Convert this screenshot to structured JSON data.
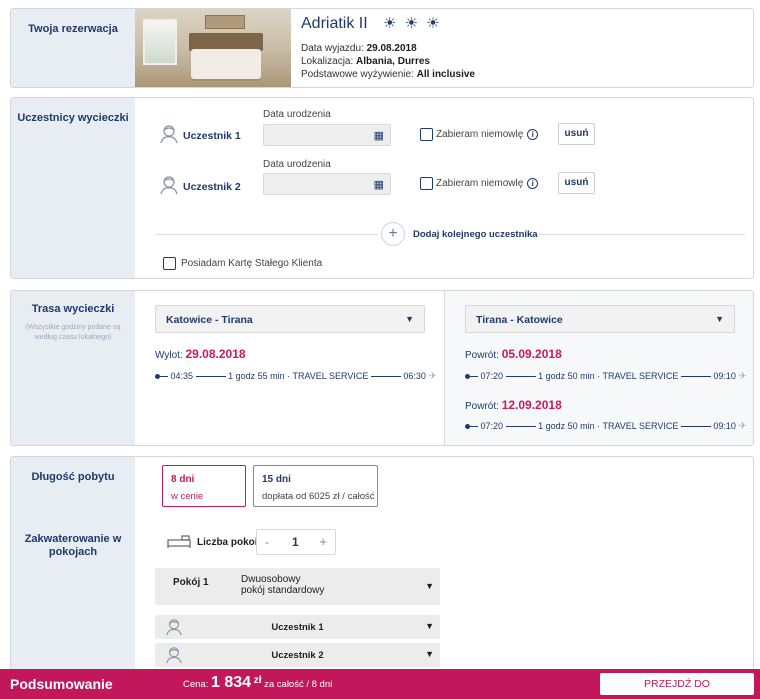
{
  "reservation": {
    "section_title": "Twoja rezerwacja",
    "hotel_name": "Adriatik II",
    "stars": "☀ ☀ ☀",
    "departure_label": "Data wyjazdu:",
    "departure_value": "29.08.2018",
    "location_label": "Lokalizacja:",
    "location_value": "Albania, Durres",
    "board_label": "Podstawowe wyżywienie:",
    "board_value": "All inclusive"
  },
  "participants": {
    "section_title": "Uczestnicy wycieczki",
    "items": [
      {
        "name": "Uczestnik 1",
        "dob_label": "Data urodzenia",
        "dob_value": "",
        "infant_label": "Zabieram niemowlę",
        "remove_label": "usuń"
      },
      {
        "name": "Uczestnik 2",
        "dob_label": "Data urodzenia",
        "dob_value": "",
        "infant_label": "Zabieram niemowlę",
        "remove_label": "usuń"
      }
    ],
    "add_label": "Dodaj kolejnego uczestnika",
    "loyalty_label": "Posiadam Kartę Stałego Klienta"
  },
  "route": {
    "section_title": "Trasa wycieczki",
    "note": "(Wszystkie godziny podane są według czasu lokalnego)",
    "outbound": {
      "select": "Katowice - Tirana",
      "date_label": "Wylot:",
      "date": "29.08.2018",
      "dep": "04:35",
      "duration": "1 godz 55 min",
      "carrier": "TRAVEL SERVICE",
      "arr": "06:30"
    },
    "return": {
      "select": "Tirana - Katowice",
      "options": [
        {
          "date_label": "Powrót:",
          "date": "05.09.2018",
          "dep": "07:20",
          "duration": "1 godz 50 min",
          "carrier": "TRAVEL SERVICE",
          "arr": "09:10"
        },
        {
          "date_label": "Powrót:",
          "date": "12.09.2018",
          "dep": "07:20",
          "duration": "1 godz 50 min",
          "carrier": "TRAVEL SERVICE",
          "arr": "09:10"
        }
      ]
    }
  },
  "stay": {
    "length_title": "Długość pobytu",
    "options": [
      {
        "days": "8 dni",
        "note": "w cenie",
        "selected": true
      },
      {
        "days": "15 dni",
        "note": "dopłata od 6025 zł / całość",
        "selected": false
      }
    ],
    "accommodation_title": "Zakwaterowanie w pokojach",
    "rooms_label": "Liczba pokoi",
    "rooms_minus": "-",
    "rooms_value": "1",
    "rooms_plus": "+",
    "room": {
      "label": "Pokój 1",
      "type": "Dwuosobowy",
      "subtype": "pokój standardowy"
    },
    "occupants": [
      "Uczestnik 1",
      "Uczestnik 2"
    ]
  },
  "footer": {
    "title": "Podsumowanie",
    "price_label": "Cena:",
    "price_value": "1 834",
    "currency": "zł",
    "price_suffix": "za całość / 8 dni",
    "cta": "PRZEJDŹ DO PODSUMOWANIA"
  },
  "colors": {
    "accent": "#c2185b",
    "navy": "#1f3a6b",
    "sidebar": "#e7edf3"
  }
}
